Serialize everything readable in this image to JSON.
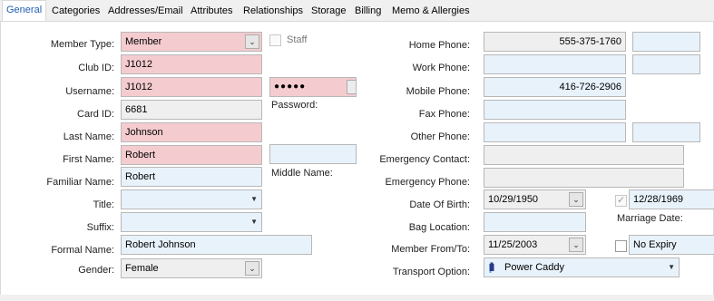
{
  "tabs": [
    {
      "label": "General"
    },
    {
      "label": "Categories"
    },
    {
      "label": "Addresses/Email"
    },
    {
      "label": "Attributes"
    },
    {
      "label": "Relationships"
    },
    {
      "label": "Storage"
    },
    {
      "label": "Billing"
    },
    {
      "label": "Memo & Allergies"
    }
  ],
  "left": {
    "member_type_label": "Member Type:",
    "member_type_value": "Member",
    "club_id_label": "Club ID:",
    "club_id_value": "J1012",
    "username_label": "Username:",
    "username_value": "J1012",
    "card_id_label": "Card ID:",
    "card_id_value": "6681",
    "last_name_label": "Last Name:",
    "last_name_value": "Johnson",
    "first_name_label": "First Name:",
    "first_name_value": "Robert",
    "familiar_name_label": "Familiar Name:",
    "familiar_name_value": "Robert",
    "title_label": "Title:",
    "title_value": "",
    "suffix_label": "Suffix:",
    "suffix_value": "",
    "formal_name_label": "Formal Name:",
    "formal_name_value": "Robert Johnson",
    "gender_label": "Gender:",
    "gender_value": "Female"
  },
  "middle": {
    "staff_label": "Staff",
    "staff_checked": false,
    "password_mask": "●●●●●",
    "password_label": "Password:",
    "middle_name_value": "",
    "middle_name_label": "Middle Name:"
  },
  "right": {
    "home_phone_label": "Home Phone:",
    "home_phone_value": "555-375-1760",
    "home_phone_ext": "",
    "work_phone_label": "Work Phone:",
    "work_phone_value": "",
    "work_phone_ext": "",
    "mobile_phone_label": "Mobile Phone:",
    "mobile_phone_value": "416-726-2906",
    "fax_phone_label": "Fax Phone:",
    "fax_phone_value": "",
    "other_phone_label": "Other Phone:",
    "other_phone_value": "",
    "other_phone_ext": "",
    "emergency_contact_label": "Emergency Contact:",
    "emergency_contact_value": "",
    "emergency_phone_label": "Emergency Phone:",
    "emergency_phone_value": "",
    "dob_label": "Date Of Birth:",
    "dob_value": "10/29/1950",
    "marriage_checked": true,
    "marriage_date_value": "12/28/1969",
    "marriage_date_label": "Marriage Date:",
    "bag_location_label": "Bag Location:",
    "bag_location_value": "",
    "member_from_label": "Member From/To:",
    "member_from_value": "11/25/2003",
    "no_expiry_checked": false,
    "member_to_value": "No Expiry",
    "transport_label": "Transport Option:",
    "transport_value": "Power Caddy"
  },
  "colors": {
    "required_field": "#f4cccf",
    "editable_field": "#e8f2fb",
    "readonly_field": "#efefef",
    "active_tab_text": "#1f5fb3"
  }
}
